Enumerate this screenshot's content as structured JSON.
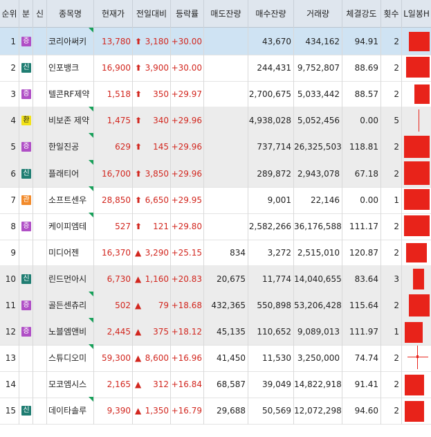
{
  "header": {
    "rank": "순위",
    "category": "분",
    "new": "신",
    "name": "종목명",
    "price": "현재가",
    "change": "전일대비",
    "rate": "등락률",
    "ask_rem": "매도잔량",
    "bid_rem": "매수잔량",
    "volume": "거래량",
    "strength": "체결강도",
    "count": "횟수",
    "candle": "L일봉H"
  },
  "colors": {
    "up": "#d2261e",
    "selected_row": "#cfe3f3",
    "grey_row": "#ececec"
  },
  "rows": [
    {
      "rank": "1",
      "tag": "증",
      "tagType": "zeung",
      "name": "코리아써키",
      "tri": true,
      "price": "13,780",
      "arrow": "up-arrow",
      "change": "3,180",
      "rate": "+30.00",
      "ask": "",
      "bid": "43,670",
      "volume": "434,162",
      "strength": "94.91",
      "count": "2",
      "style": "sel",
      "candle": {
        "x": 10,
        "w": 30,
        "y": 6,
        "h": 28
      }
    },
    {
      "rank": "2",
      "tag": "신",
      "tagType": "sin",
      "name": "인포뱅크",
      "tri": false,
      "price": "16,900",
      "arrow": "up-arrow",
      "change": "3,900",
      "rate": "+30.00",
      "ask": "",
      "bid": "244,431",
      "volume": "9,752,807",
      "strength": "88.69",
      "count": "2",
      "style": "",
      "candle": {
        "x": 6,
        "w": 34,
        "y": 4,
        "h": 30
      }
    },
    {
      "rank": "3",
      "tag": "증",
      "tagType": "zeung",
      "name": "텔콘RF제약",
      "tri": false,
      "price": "1,518",
      "arrow": "up-arrow",
      "change": "350",
      "rate": "+29.97",
      "ask": "",
      "bid": "2,700,675",
      "volume": "5,033,442",
      "strength": "88.57",
      "count": "2",
      "style": "",
      "candle": {
        "x": 18,
        "w": 22,
        "y": 6,
        "h": 28
      }
    },
    {
      "rank": "4",
      "tag": "환",
      "tagType": "hwan",
      "name": "비보존 제약",
      "tri": true,
      "price": "1,475",
      "arrow": "up-arrow",
      "change": "340",
      "rate": "+29.96",
      "ask": "",
      "bid": "4,938,028",
      "volume": "5,052,456",
      "strength": "0.00",
      "count": "5",
      "style": "grey",
      "candle": {
        "x": 24,
        "w": 1,
        "y": 4,
        "h": 32
      }
    },
    {
      "rank": "5",
      "tag": "증",
      "tagType": "zeung",
      "name": "한일진공",
      "tri": true,
      "price": "629",
      "arrow": "up-arrow",
      "change": "145",
      "rate": "+29.96",
      "ask": "",
      "bid": "737,714",
      "volume": "26,325,503",
      "strength": "118.81",
      "count": "2",
      "style": "grey",
      "candle": {
        "x": 3,
        "w": 37,
        "y": 4,
        "h": 32
      }
    },
    {
      "rank": "6",
      "tag": "신",
      "tagType": "sin",
      "name": "플래티어",
      "tri": true,
      "price": "16,700",
      "arrow": "up-arrow",
      "change": "3,850",
      "rate": "+29.96",
      "ask": "",
      "bid": "289,872",
      "volume": "2,943,078",
      "strength": "67.18",
      "count": "2",
      "style": "grey",
      "candle": {
        "x": 3,
        "w": 37,
        "y": 2,
        "h": 34
      }
    },
    {
      "rank": "7",
      "tag": "관",
      "tagType": "gwan",
      "name": "소프트센우",
      "tri": true,
      "price": "28,850",
      "arrow": "up-arrow",
      "change": "6,650",
      "rate": "+29.95",
      "ask": "",
      "bid": "9,001",
      "volume": "22,146",
      "strength": "0.00",
      "count": "1",
      "style": "",
      "candle": {
        "x": 3,
        "w": 37,
        "y": 4,
        "h": 30
      }
    },
    {
      "rank": "8",
      "tag": "증",
      "tagType": "zeung",
      "name": "케이피엠테",
      "tri": true,
      "price": "527",
      "arrow": "up-arrow",
      "change": "121",
      "rate": "+29.80",
      "ask": "",
      "bid": "2,582,266",
      "volume": "36,176,588",
      "strength": "111.17",
      "count": "2",
      "style": "",
      "candle": {
        "x": 3,
        "w": 37,
        "y": 4,
        "h": 30
      }
    },
    {
      "rank": "9",
      "tag": "",
      "tagType": "",
      "name": "미디어젠",
      "tri": false,
      "price": "16,370",
      "arrow": "up-triangle",
      "change": "3,290",
      "rate": "+25.15",
      "ask": "834",
      "bid": "3,272",
      "volume": "2,515,010",
      "strength": "120.87",
      "count": "2",
      "style": "",
      "candle": {
        "x": 6,
        "w": 30,
        "y": 6,
        "h": 28
      }
    },
    {
      "rank": "10",
      "tag": "신",
      "tagType": "sin",
      "name": "린드먼아시",
      "tri": false,
      "price": "6,730",
      "arrow": "up-triangle",
      "change": "1,160",
      "rate": "+20.83",
      "ask": "20,675",
      "bid": "11,774",
      "volume": "14,040,655",
      "strength": "83.64",
      "count": "3",
      "style": "grey",
      "candle": {
        "x": 16,
        "w": 16,
        "y": 5,
        "h": 30
      }
    },
    {
      "rank": "11",
      "tag": "증",
      "tagType": "zeung",
      "name": "골든센츄리",
      "tri": true,
      "price": "502",
      "arrow": "up-triangle",
      "change": "79",
      "rate": "+18.68",
      "ask": "432,365",
      "bid": "550,898",
      "volume": "53,206,428",
      "strength": "115.64",
      "count": "2",
      "style": "grey",
      "candle": {
        "x": 10,
        "w": 30,
        "y": 4,
        "h": 32
      }
    },
    {
      "rank": "12",
      "tag": "증",
      "tagType": "zeung",
      "name": "노블엠앤비",
      "tri": true,
      "price": "2,445",
      "arrow": "up-triangle",
      "change": "375",
      "rate": "+18.12",
      "ask": "45,135",
      "bid": "110,652",
      "volume": "9,089,013",
      "strength": "111.97",
      "count": "1",
      "style": "grey",
      "candle": {
        "x": 4,
        "w": 26,
        "y": 6,
        "h": 30
      }
    },
    {
      "rank": "13",
      "tag": "",
      "tagType": "",
      "name": "스튜디오미",
      "tri": true,
      "price": "59,300",
      "arrow": "up-triangle",
      "change": "8,600",
      "rate": "+16.96",
      "ask": "41,450",
      "bid": "11,530",
      "volume": "3,250,000",
      "strength": "74.74",
      "count": "2",
      "style": "",
      "candle": {
        "x": 21,
        "w": 3,
        "y": 16,
        "h": 4
      }
    },
    {
      "rank": "14",
      "tag": "",
      "tagType": "",
      "name": "모코엠시스",
      "tri": false,
      "price": "2,165",
      "arrow": "up-triangle",
      "change": "312",
      "rate": "+16.84",
      "ask": "68,587",
      "bid": "39,049",
      "volume": "14,822,918",
      "strength": "91.41",
      "count": "2",
      "style": "",
      "candle": {
        "x": 4,
        "w": 28,
        "y": 6,
        "h": 30
      }
    },
    {
      "rank": "15",
      "tag": "신",
      "tagType": "sin",
      "name": "데이타솔루",
      "tri": true,
      "price": "9,390",
      "arrow": "up-triangle",
      "change": "1,350",
      "rate": "+16.79",
      "ask": "29,688",
      "bid": "50,569",
      "volume": "12,072,298",
      "strength": "94.60",
      "count": "2",
      "style": "",
      "candle": {
        "x": 4,
        "w": 28,
        "y": 6,
        "h": 30
      }
    }
  ]
}
